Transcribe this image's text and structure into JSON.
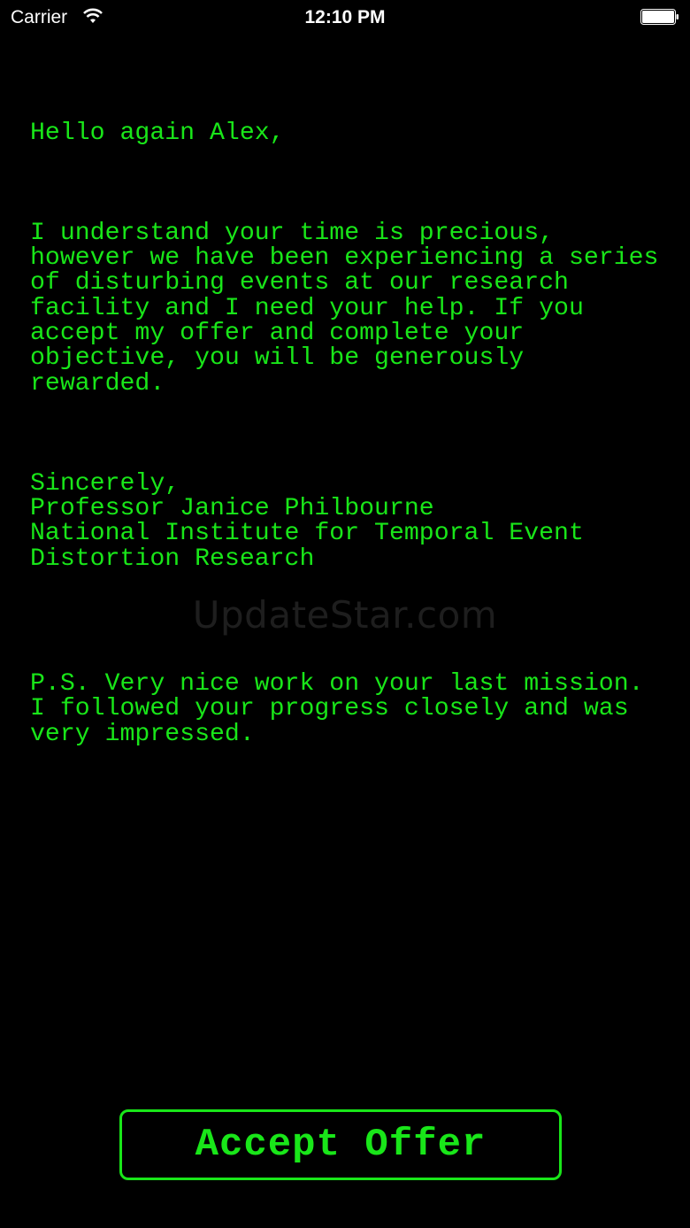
{
  "status_bar": {
    "carrier": "Carrier",
    "time": "12:10 PM",
    "wifi_icon": "wifi-icon",
    "battery_icon": "battery-icon"
  },
  "message": {
    "greeting": "Hello again Alex,",
    "body_lines": [
      "I understand your time is precious,",
      "however we have been experiencing a series",
      "of disturbing events at our research",
      "facility and I need your help. If you",
      "accept my offer and complete your",
      "objective, you will be generously",
      "rewarded."
    ],
    "signoff_lines": [
      "Sincerely,",
      "Professor Janice Philbourne",
      "National Institute for Temporal Event",
      "Distortion Research"
    ],
    "postscript_lines": [
      "P.S. Very nice work on your last mission.",
      "I followed your progress closely and was",
      "very impressed."
    ]
  },
  "watermark": "UpdateStar.com",
  "accept_button_label": "Accept Offer",
  "colors": {
    "terminal_green": "#19e619",
    "background": "#000000"
  }
}
